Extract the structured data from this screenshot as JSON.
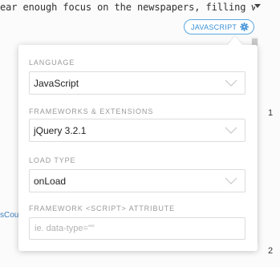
{
  "editor": {
    "top_line_text": "ear enough focus on the newspapers, filling with",
    "left_snippet_text": "sCou",
    "line_numbers": [
      "1",
      "2"
    ]
  },
  "language_badge": {
    "label": "JAVASCRIPT",
    "icon": "gear-icon",
    "accent_color": "#3a8fd6"
  },
  "settings_panel": {
    "language": {
      "label": "LANGUAGE",
      "value": "JavaScript"
    },
    "frameworks": {
      "label": "FRAMEWORKS & EXTENSIONS",
      "value": "jQuery 3.2.1"
    },
    "load_type": {
      "label": "LOAD TYPE",
      "value": "onLoad"
    },
    "script_attribute": {
      "label": "FRAMEWORK <SCRIPT> ATTRIBUTE",
      "placeholder": "ie. data-type=\"\"",
      "value": ""
    }
  }
}
